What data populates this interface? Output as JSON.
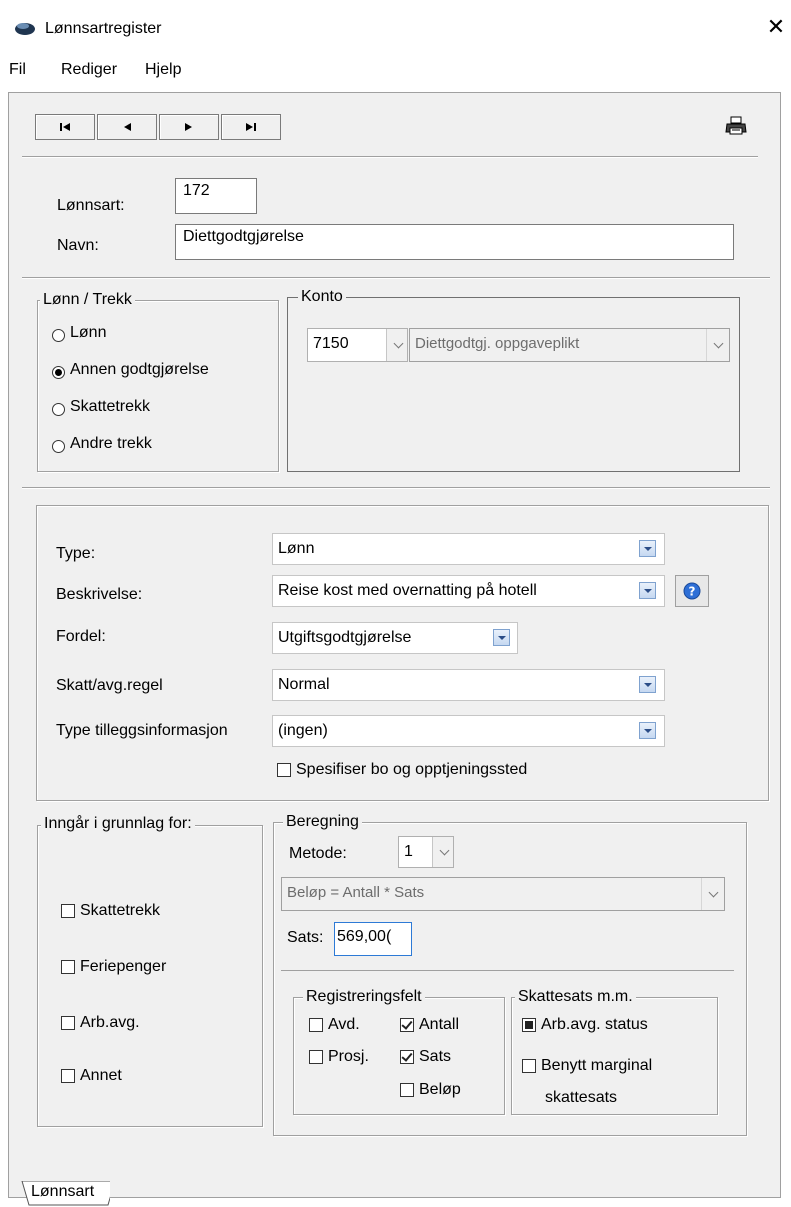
{
  "window": {
    "title": "Lønnsartregister",
    "close_glyph": "✕"
  },
  "menu": [
    "Fil",
    "Rediger",
    "Hjelp"
  ],
  "nav": {
    "first": "first-record-icon",
    "prev": "prev-record-icon",
    "next": "next-record-icon",
    "last": "last-record-icon",
    "print": "printer-icon"
  },
  "header": {
    "lonnsart_label": "Lønnsart:",
    "lonnsart_value": "172",
    "navn_label": "Navn:",
    "navn_value": "Diettgodtgjørelse"
  },
  "lonn_trekk": {
    "title": "Lønn / Trekk",
    "options": [
      {
        "label": "Lønn",
        "selected": false
      },
      {
        "label": "Annen godtgjørelse",
        "selected": true
      },
      {
        "label": "Skattetrekk",
        "selected": false
      },
      {
        "label": "Andre trekk",
        "selected": false
      }
    ]
  },
  "konto": {
    "title": "Konto",
    "number": "7150",
    "description": "Diettgodtgj. oppgaveplikt"
  },
  "fields": {
    "type_label": "Type:",
    "type_value": "Lønn",
    "beskrivelse_label": "Beskrivelse:",
    "beskrivelse_value": "Reise kost med overnatting på hotell",
    "fordel_label": "Fordel:",
    "fordel_value": "Utgiftsgodtgjørelse",
    "skatt_label": "Skatt/avg.regel",
    "skatt_value": "Normal",
    "tillegg_label": "Type tilleggsinformasjon",
    "tillegg_value": "(ingen)",
    "spesifiser_label": "Spesifiser bo og opptjeningssted",
    "spesifiser_checked": false
  },
  "grunnlag": {
    "title": "Inngår i grunnlag for:",
    "items": [
      {
        "label": "Skattetrekk",
        "checked": false
      },
      {
        "label": "Feriepenger",
        "checked": false
      },
      {
        "label": "Arb.avg.",
        "checked": false
      },
      {
        "label": "Annet",
        "checked": false
      }
    ]
  },
  "beregning": {
    "title": "Beregning",
    "metode_label": "Metode:",
    "metode_value": "1",
    "formel": "Beløp = Antall * Sats",
    "sats_label": "Sats:",
    "sats_value": "569,00("
  },
  "registreringsfelt": {
    "title": "Registreringsfelt",
    "avd": "Avd.",
    "antall": "Antall",
    "prosj": "Prosj.",
    "sats": "Sats",
    "belop": "Beløp"
  },
  "skattesats": {
    "title": "Skattesats m.m.",
    "arbavg": "Arb.avg. status",
    "marginal_line1": "Benytt marginal",
    "marginal_line2": "skattesats"
  },
  "tabs": [
    "Lønnsart"
  ]
}
